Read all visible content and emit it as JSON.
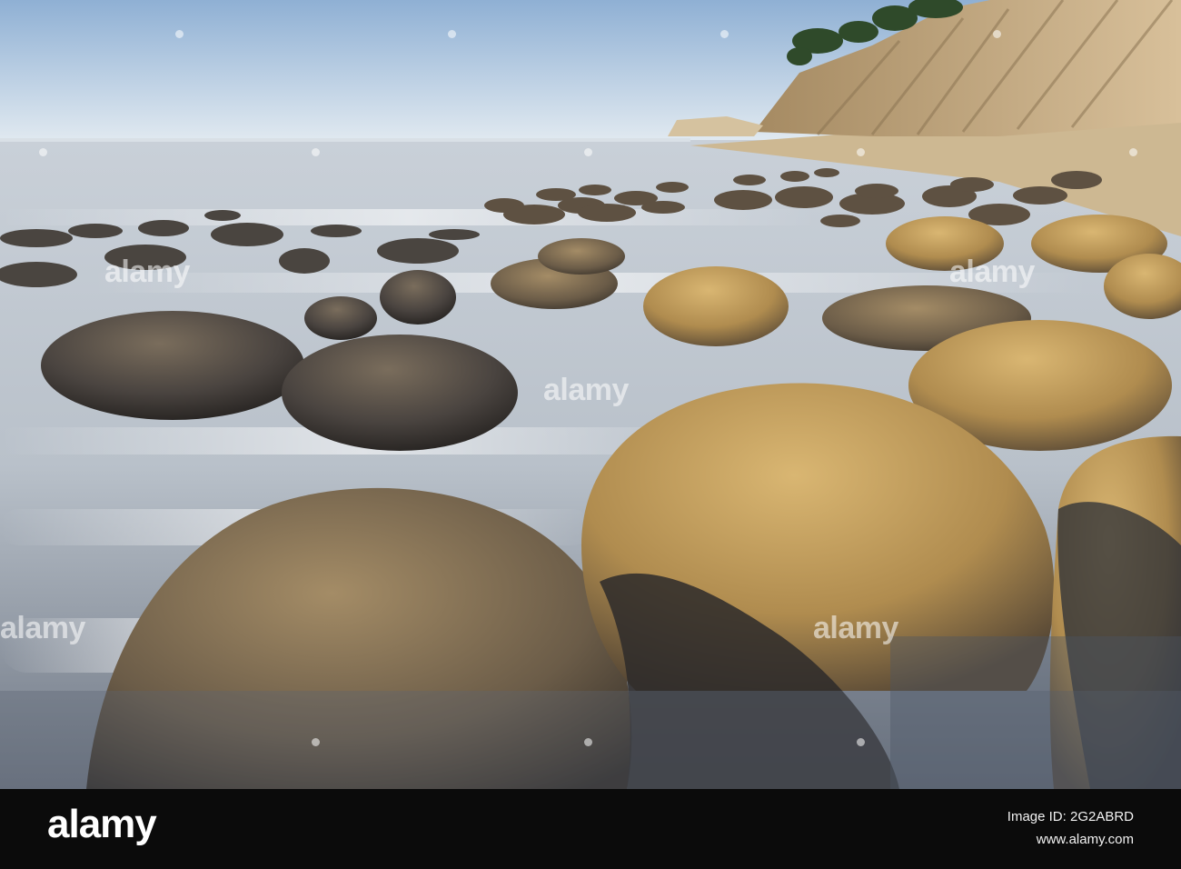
{
  "photo": {
    "description_icon": "coastal-boulders-photo",
    "colors": {
      "sky_top": "#8fb2d6",
      "sky_horizon": "#dfe8ef",
      "mist": "#cfd6de",
      "cliff": "#c9ae82",
      "boulder_light": "#c9a35e",
      "boulder_dark": "#3e3a36"
    }
  },
  "watermark": {
    "text": "alamy"
  },
  "banner": {
    "brand": "alamy",
    "image_id": "Image ID: 2G2ABRD",
    "site": "www.alamy.com"
  }
}
